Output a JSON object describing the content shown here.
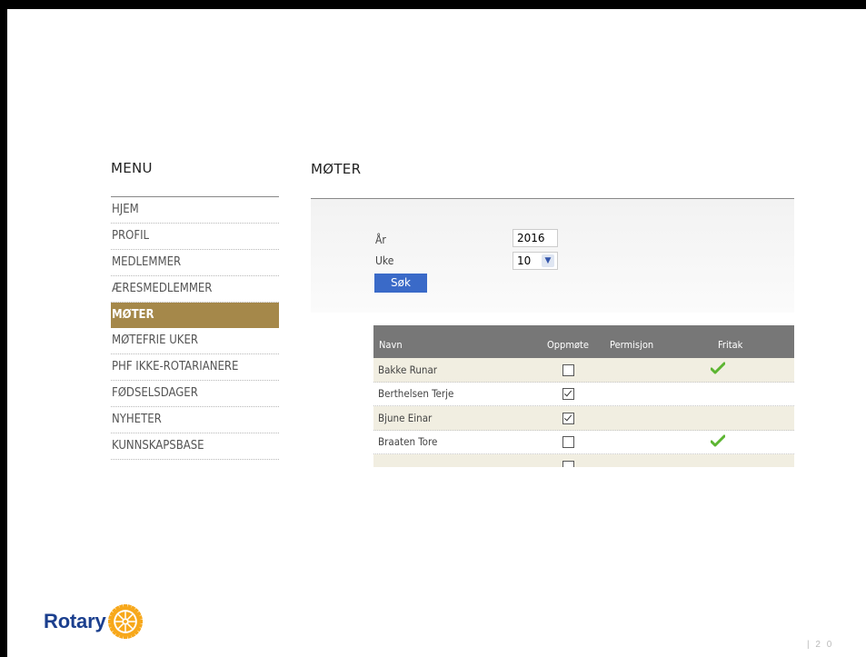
{
  "menu": {
    "title": "MENU",
    "items": [
      {
        "label": "HJEM",
        "active": false
      },
      {
        "label": "PROFIL",
        "active": false
      },
      {
        "label": "MEDLEMMER",
        "active": false
      },
      {
        "label": "ÆRESMEDLEMMER",
        "active": false
      },
      {
        "label": "MØTER",
        "active": true
      },
      {
        "label": "MØTEFRIE UKER",
        "active": false
      },
      {
        "label": "PHF IKKE-ROTARIANERE",
        "active": false
      },
      {
        "label": "FØDSELSDAGER",
        "active": false
      },
      {
        "label": "NYHETER",
        "active": false
      },
      {
        "label": "KUNNSKAPSBASE",
        "active": false
      }
    ]
  },
  "page": {
    "title": "MØTER"
  },
  "form": {
    "year_label": "År",
    "year_value": "2016",
    "week_label": "Uke",
    "week_value": "10",
    "search_label": "Søk"
  },
  "table": {
    "columns": [
      "Navn",
      "Oppmøte",
      "Permisjon",
      "Fritak"
    ],
    "rows": [
      {
        "name": "Bakke Runar",
        "oppmote": false,
        "fritak": true
      },
      {
        "name": "Berthelsen Terje",
        "oppmote": true,
        "fritak": false
      },
      {
        "name": "Bjune Einar",
        "oppmote": true,
        "fritak": false
      },
      {
        "name": "Braaten Tore",
        "oppmote": false,
        "fritak": true
      }
    ]
  },
  "footer": {
    "logo_text": "Rotary",
    "page_number": "| 2 0"
  },
  "colors": {
    "menu_active": "#a5884a",
    "table_header": "#777777",
    "button": "#3a6ac8",
    "row_alt": "#f1eee1",
    "rotary_blue": "#1b3f8e",
    "rotary_gold": "#f7a81b"
  }
}
